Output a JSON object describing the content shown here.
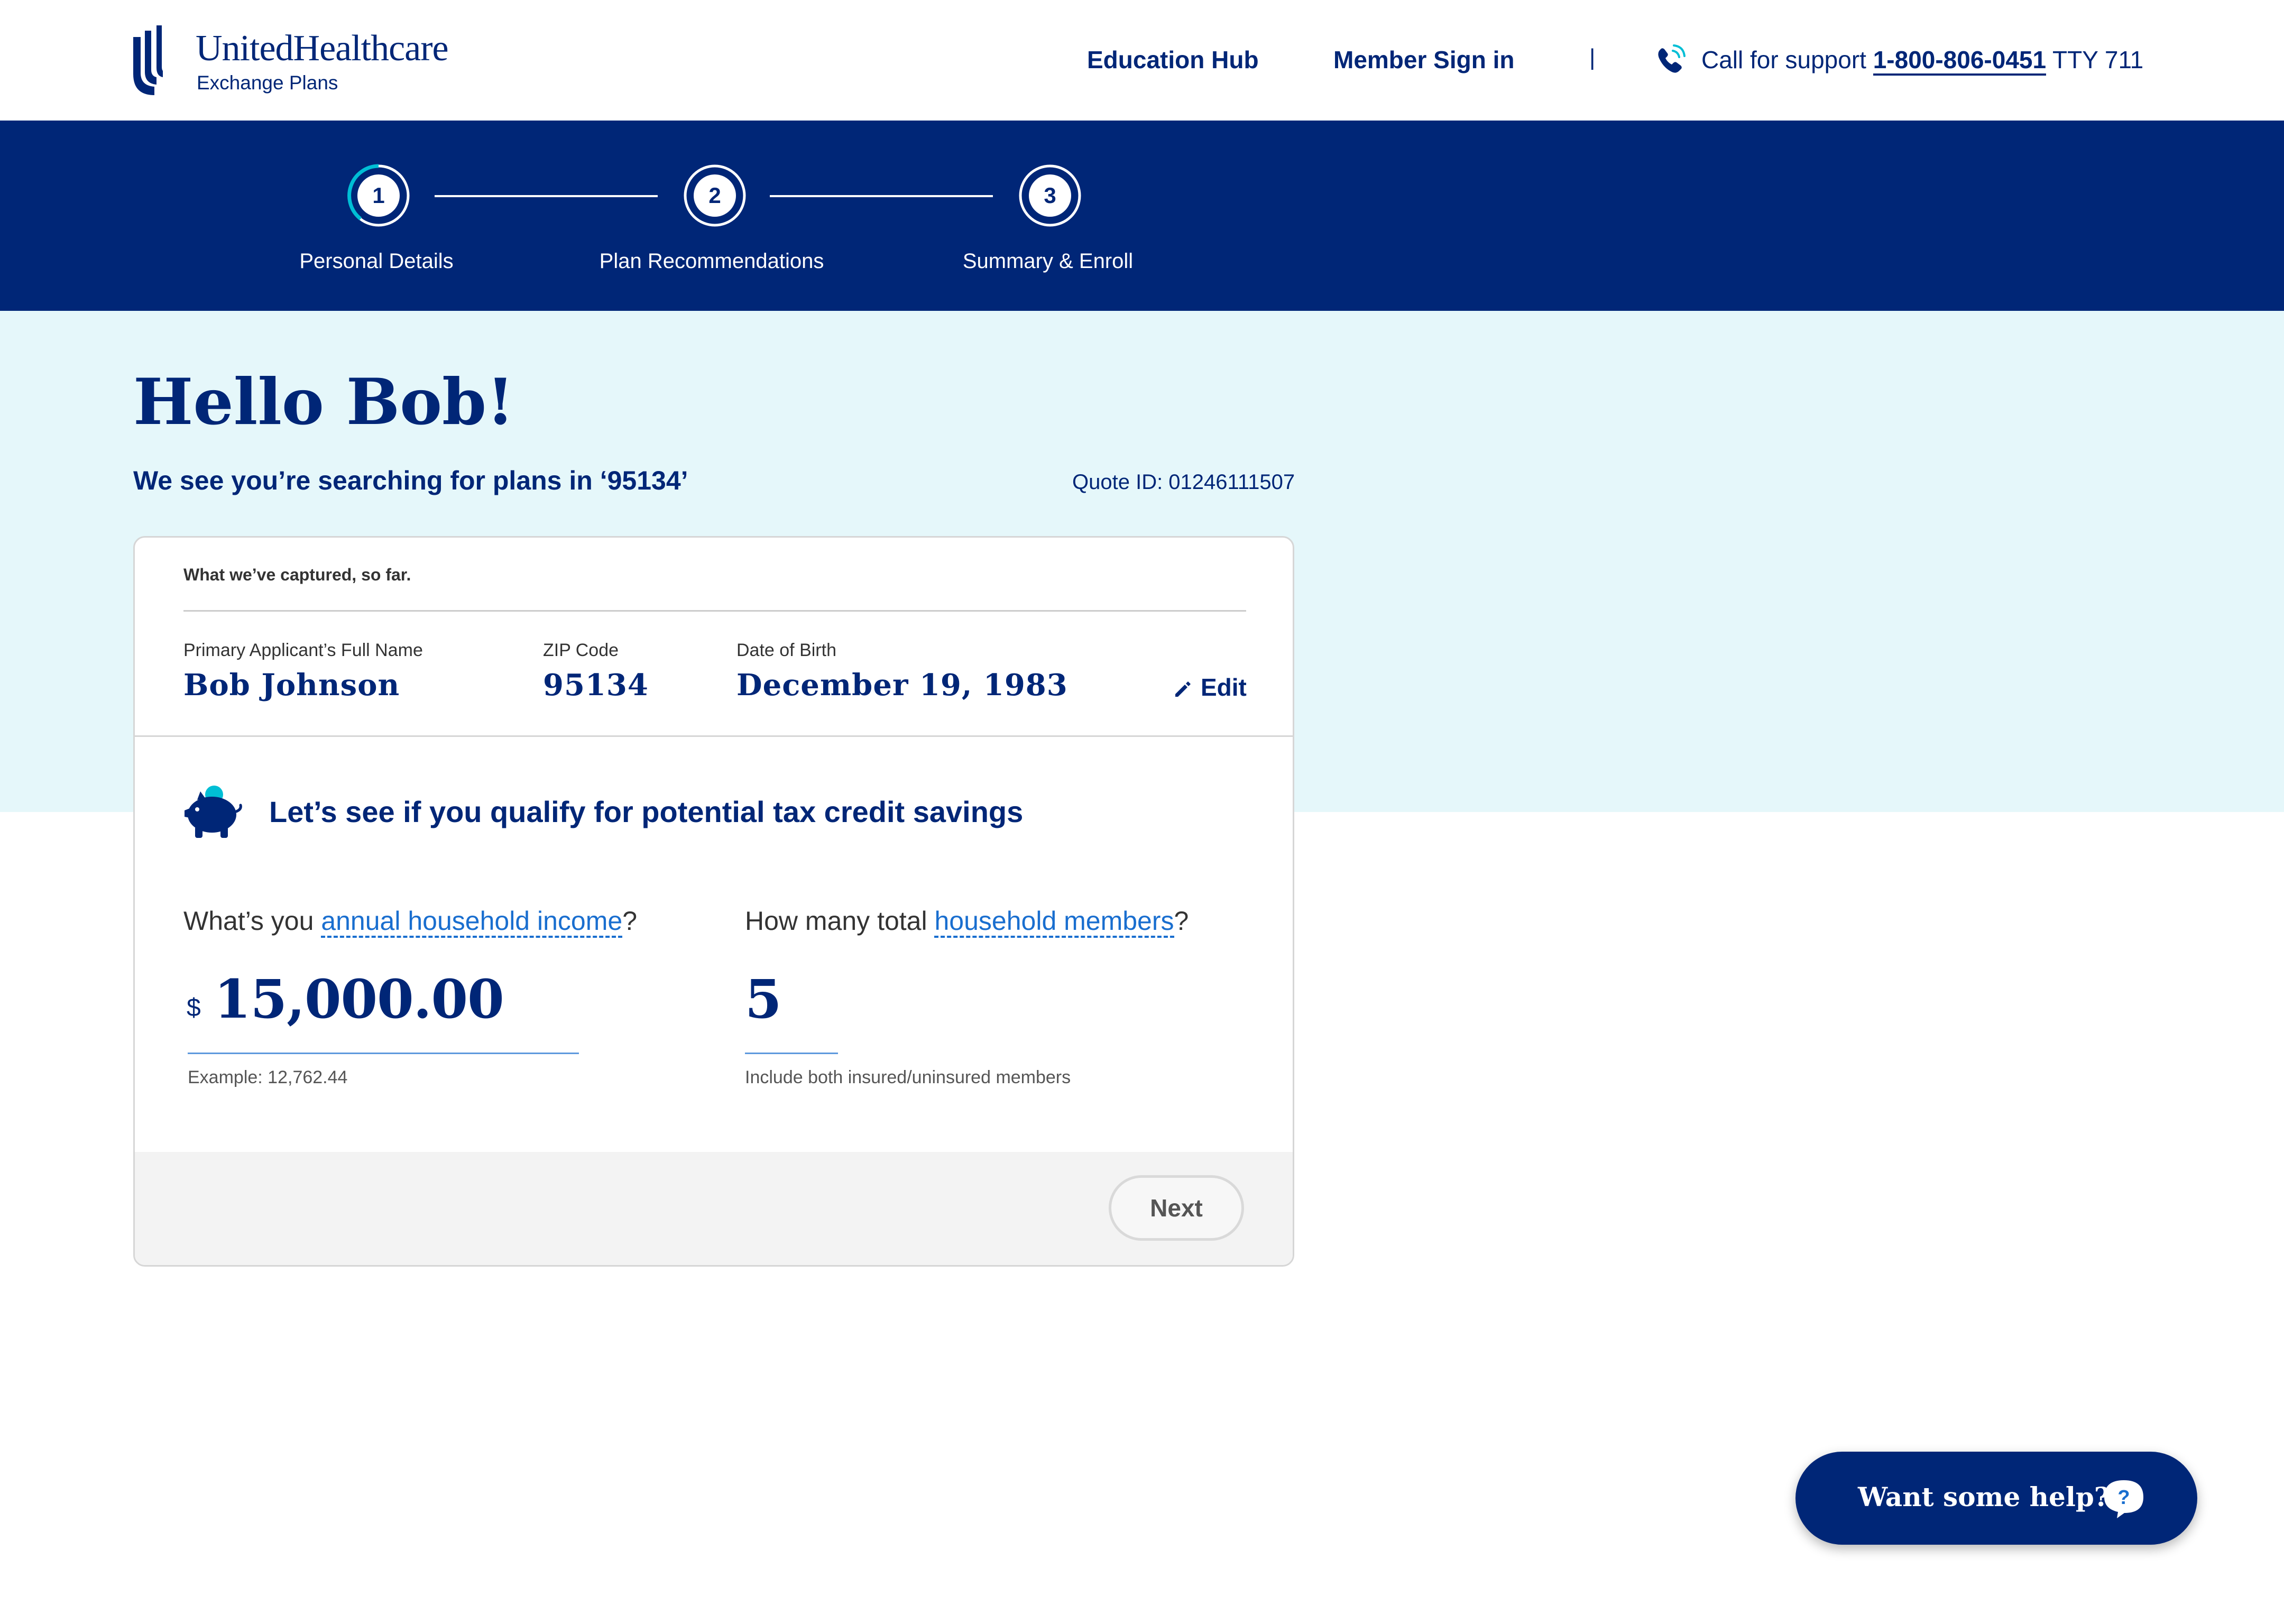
{
  "header": {
    "brand_title": "UnitedHealthcare",
    "brand_sub": "Exchange Plans",
    "nav": [
      {
        "label": "Education Hub"
      },
      {
        "label": "Member Sign in"
      }
    ],
    "separator": "|",
    "support_prefix": "Call for support",
    "support_number": "1-800-806-0451",
    "support_tty": "TTY 711"
  },
  "steps": [
    {
      "number": "1",
      "label": "Personal Details",
      "state": "current"
    },
    {
      "number": "2",
      "label": "Plan Recommendations",
      "state": "upcoming"
    },
    {
      "number": "3",
      "label": "Summary & Enroll",
      "state": "upcoming"
    }
  ],
  "greeting": {
    "title": "Hello Bob!",
    "subtitle": "We see you’re searching for plans in ‘95134’",
    "quote_id": "Quote ID: 01246111507"
  },
  "summary": {
    "heading": "What we’ve captured, so far.",
    "fields": [
      {
        "label": "Primary Applicant’s Full Name",
        "value": "Bob Johnson"
      },
      {
        "label": "ZIP Code",
        "value": "95134"
      },
      {
        "label": "Date of Birth",
        "value": "December 19, 1983"
      }
    ],
    "edit_label": "Edit"
  },
  "tax": {
    "title": "Let’s see if you qualify for potential tax credit savings",
    "income": {
      "q_prefix": "What’s you ",
      "q_link": "annual household income",
      "q_suffix": "?",
      "currency": "$",
      "value": "15,000.00",
      "hint": "Example: 12,762.44"
    },
    "members": {
      "q_prefix": "How many total ",
      "q_link": "household members",
      "q_suffix": "?",
      "value": "5",
      "hint": "Include both insured/uninsured members"
    },
    "next_label": "Next"
  },
  "help": {
    "label": "Want some help?"
  },
  "colors": {
    "brand_navy": "#002677",
    "light_band": "#e5f7fa",
    "link_blue": "#196ecf",
    "accent_teal": "#00bed5"
  },
  "icons": [
    "uhc-logo-icon",
    "phone-icon",
    "edit-pencil-icon",
    "piggy-bank-icon",
    "help-chat-icon"
  ]
}
